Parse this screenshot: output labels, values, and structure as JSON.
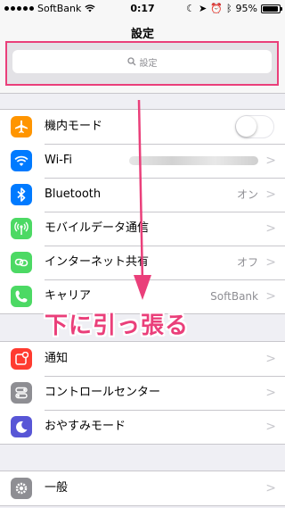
{
  "status_bar": {
    "carrier": "SoftBank",
    "time": "0:17",
    "battery": "95%",
    "battery_level": 0.95
  },
  "nav": {
    "title": "設定",
    "search_placeholder": "設定"
  },
  "groups": [
    {
      "rows": [
        {
          "name": "airplane-mode",
          "label": "機内モード",
          "value": "",
          "control": "toggle",
          "toggle_on": false,
          "icon": "airplane-icon",
          "icon_bg": "#ff9500"
        },
        {
          "name": "wifi",
          "label": "Wi-Fi",
          "value": "",
          "control": "blurred",
          "icon": "wifi-icon",
          "icon_bg": "#007aff"
        },
        {
          "name": "bluetooth",
          "label": "Bluetooth",
          "value": "オン",
          "control": "chevron",
          "icon": "bluetooth-icon",
          "icon_bg": "#007aff"
        },
        {
          "name": "cellular",
          "label": "モバイルデータ通信",
          "value": "",
          "control": "chevron",
          "icon": "cellular-icon",
          "icon_bg": "#4cd964"
        },
        {
          "name": "hotspot",
          "label": "インターネット共有",
          "value": "オフ",
          "control": "chevron",
          "icon": "hotspot-icon",
          "icon_bg": "#4cd964"
        },
        {
          "name": "carrier",
          "label": "キャリア",
          "value": "SoftBank",
          "control": "chevron",
          "icon": "phone-icon",
          "icon_bg": "#4cd964"
        }
      ]
    },
    {
      "rows": [
        {
          "name": "notifications",
          "label": "通知",
          "value": "",
          "control": "chevron",
          "icon": "notifications-icon",
          "icon_bg": "#ff3b30"
        },
        {
          "name": "control-center",
          "label": "コントロールセンター",
          "value": "",
          "control": "chevron",
          "icon": "control-center-icon",
          "icon_bg": "#8e8e93"
        },
        {
          "name": "do-not-disturb",
          "label": "おやすみモード",
          "value": "",
          "control": "chevron",
          "icon": "moon-icon",
          "icon_bg": "#5856d6"
        }
      ]
    },
    {
      "rows": [
        {
          "name": "general",
          "label": "一般",
          "value": "",
          "control": "chevron",
          "icon": "gear-icon",
          "icon_bg": "#8e8e93"
        }
      ]
    }
  ],
  "annotation": {
    "caption": "下に引っ張る",
    "color": "#ea3f7a"
  }
}
